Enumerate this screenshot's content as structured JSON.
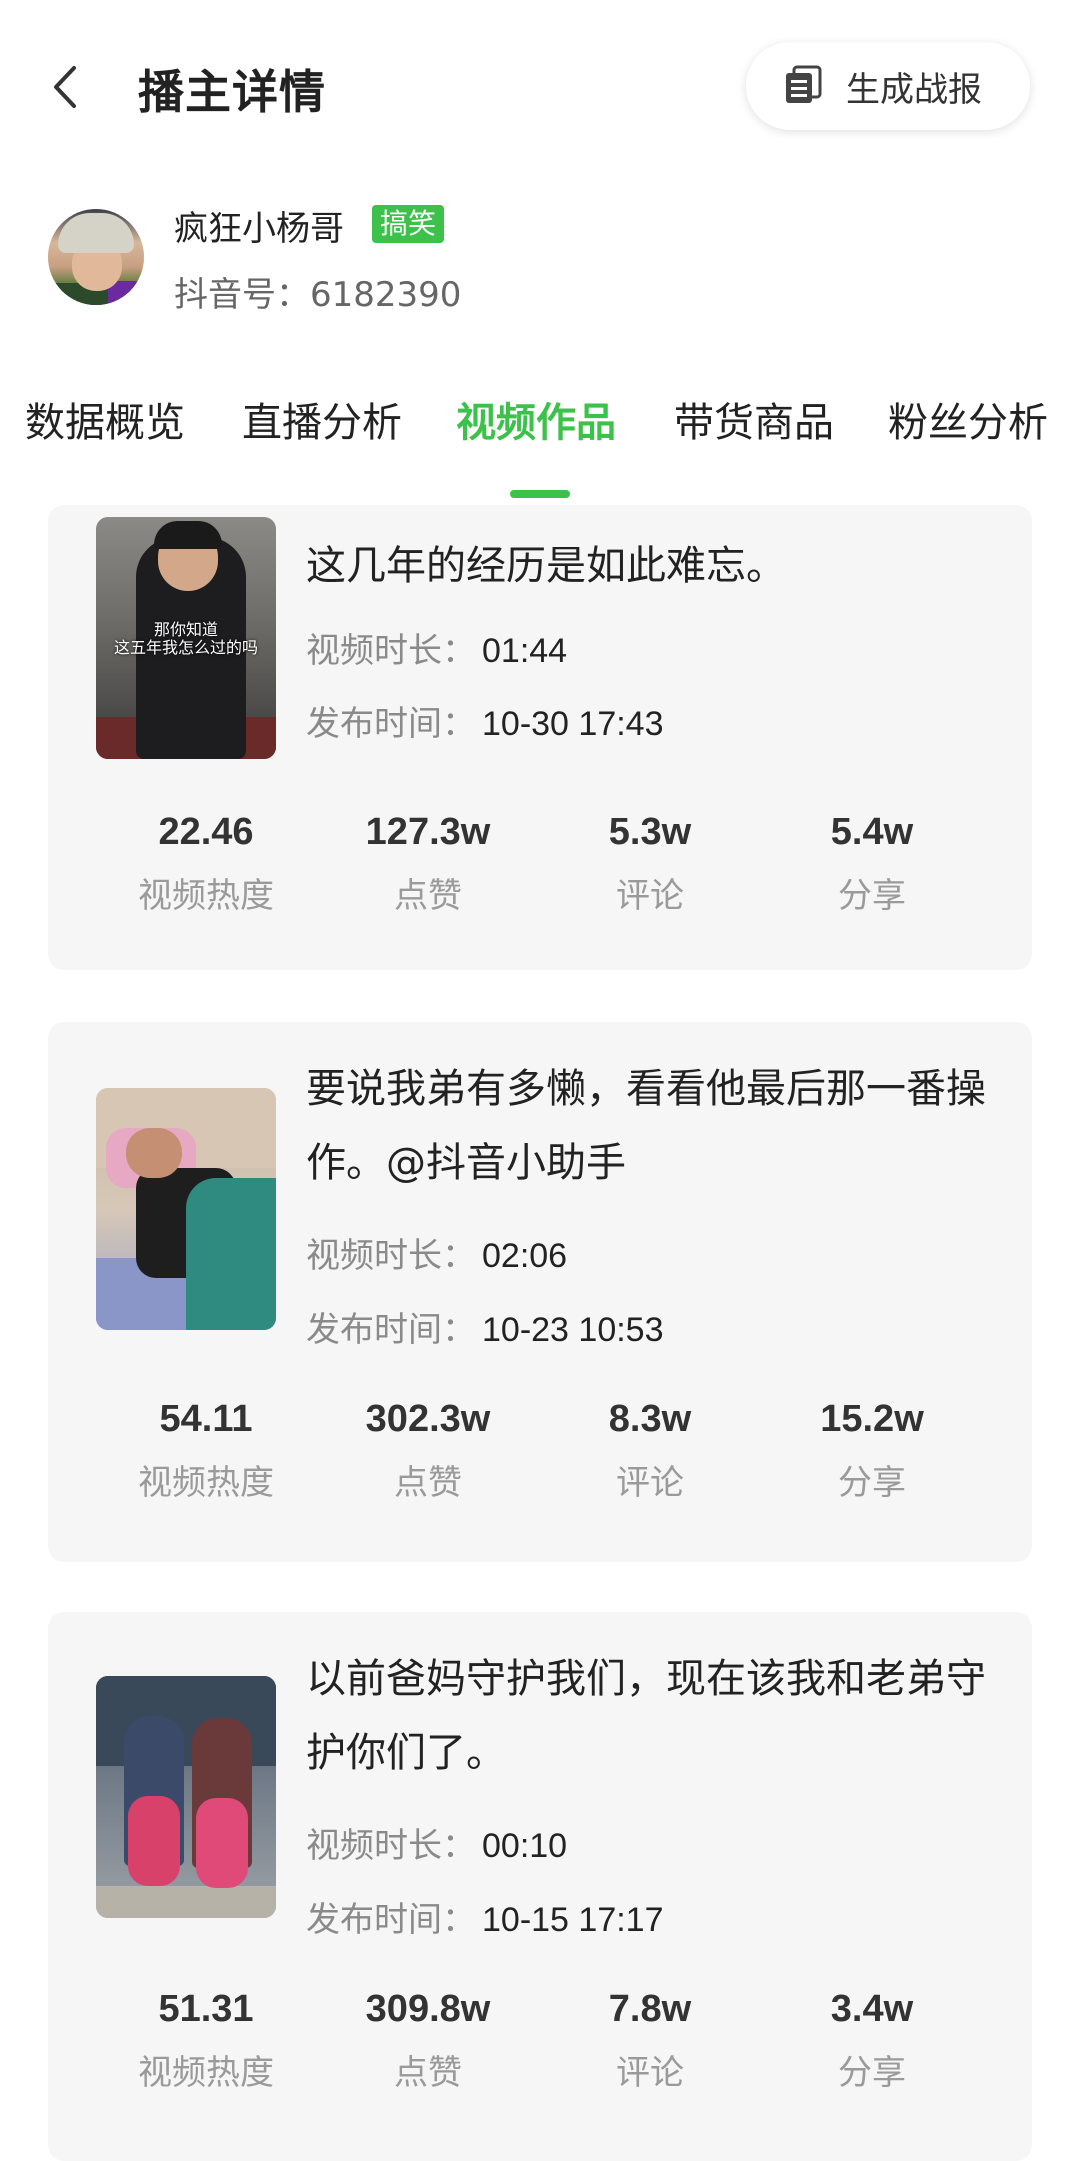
{
  "header": {
    "title": "播主详情",
    "report_button": "生成战报",
    "back_icon": "chevron-left-icon",
    "report_icon": "document-icon"
  },
  "profile": {
    "name": "疯狂小杨哥",
    "tag": "搞笑",
    "douyin_id": "抖音号：6182390"
  },
  "tabs": [
    {
      "label": "数据概览",
      "active": false
    },
    {
      "label": "直播分析",
      "active": false
    },
    {
      "label": "视频作品",
      "active": true
    },
    {
      "label": "带货商品",
      "active": false
    },
    {
      "label": "粉丝分析",
      "active": false
    }
  ],
  "meta_labels": {
    "duration": "视频时长：",
    "publish": "发布时间："
  },
  "stat_labels": [
    "视频热度",
    "点赞",
    "评论",
    "分享"
  ],
  "videos": [
    {
      "title": "这几年的经历是如此难忘。",
      "thumb_caption": "那你知道\n这五年我怎么过的吗",
      "duration": "01:44",
      "publish_time": "10-30 17:43",
      "stats": [
        "22.46",
        "127.3w",
        "5.3w",
        "5.4w"
      ]
    },
    {
      "title": "要说我弟有多懒，看看他最后那一番操作。@抖音小助手",
      "duration": "02:06",
      "publish_time": "10-23 10:53",
      "stats": [
        "54.11",
        "302.3w",
        "8.3w",
        "15.2w"
      ]
    },
    {
      "title": "以前爸妈守护我们，现在该我和老弟守护你们了。",
      "duration": "00:10",
      "publish_time": "10-15 17:17",
      "stats": [
        "51.31",
        "309.8w",
        "7.8w",
        "3.4w"
      ]
    }
  ],
  "colors": {
    "accent": "#3cc14a",
    "card_bg": "#f6f6f6",
    "muted_text": "#8a8a8a"
  }
}
